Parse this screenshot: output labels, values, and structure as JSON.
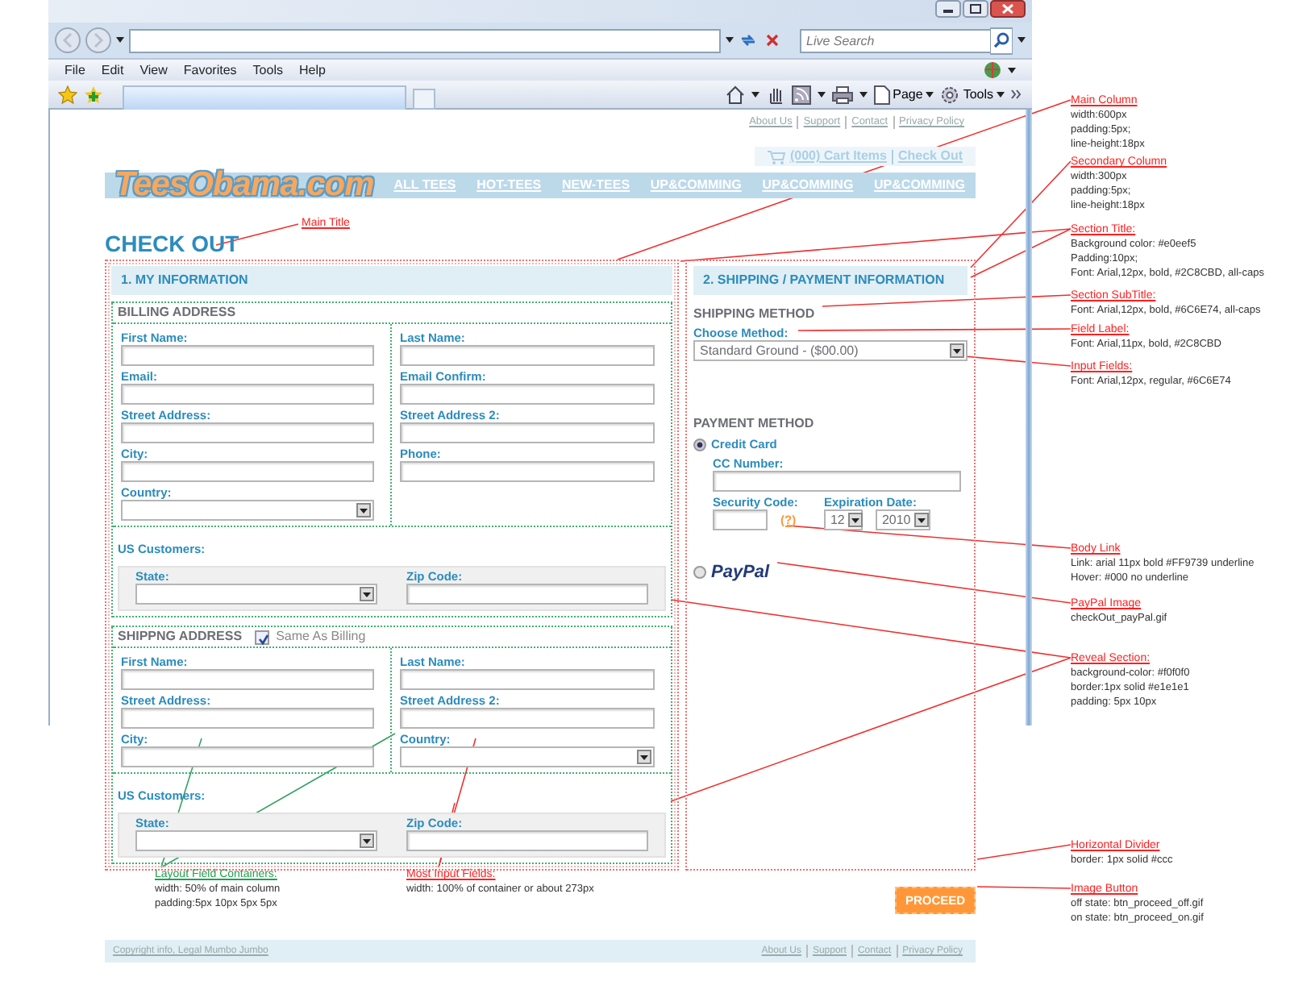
{
  "browser": {
    "search_placeholder": "Live Search",
    "menu": [
      "File",
      "Edit",
      "View",
      "Favorites",
      "Tools",
      "Help"
    ],
    "toolbar_buttons": [
      "Page",
      "Tools"
    ]
  },
  "site": {
    "top_links": [
      "About Us",
      "Support",
      "Contact",
      "Privacy Policy"
    ],
    "cart_link": "(000) Cart Items",
    "checkout_link": "Check Out",
    "logo": "TeesObama.com",
    "nav": [
      "ALL TEES",
      "HOT-TEES",
      "NEW-TEES",
      "UP&COMMING",
      "UP&COMMING",
      "UP&COMMING"
    ]
  },
  "page_title": "CHECK OUT",
  "main_column": {
    "section_title": "1. MY INFORMATION",
    "billing": {
      "title": "BILLING ADDRESS",
      "left_fields": [
        {
          "label": "First Name:",
          "kind": "text"
        },
        {
          "label": "Email:",
          "kind": "text"
        },
        {
          "label": "Street Address:",
          "kind": "text"
        },
        {
          "label": "City:",
          "kind": "text"
        },
        {
          "label": "Country:",
          "kind": "select"
        }
      ],
      "right_fields": [
        {
          "label": "Last Name:",
          "kind": "text"
        },
        {
          "label": "Email Confirm:",
          "kind": "text"
        },
        {
          "label": "Street Address 2:",
          "kind": "text"
        },
        {
          "label": "Phone:",
          "kind": "text"
        }
      ],
      "us_customers": {
        "label": "US Customers:",
        "fields": [
          {
            "label": "State:",
            "kind": "select"
          },
          {
            "label": "Zip Code:",
            "kind": "text"
          }
        ]
      }
    },
    "shipping": {
      "title": "SHIPPNG ADDRESS",
      "same_as_billing": {
        "label": "Same As Billing",
        "checked": true
      },
      "left_fields": [
        {
          "label": "First Name:",
          "kind": "text"
        },
        {
          "label": "Street Address:",
          "kind": "text"
        },
        {
          "label": "City:",
          "kind": "text"
        }
      ],
      "right_fields": [
        {
          "label": "Last Name:",
          "kind": "text"
        },
        {
          "label": "Street Address 2:",
          "kind": "text"
        },
        {
          "label": "Country:",
          "kind": "select"
        }
      ],
      "us_customers": {
        "label": "US Customers:",
        "fields": [
          {
            "label": "State:",
            "kind": "select"
          },
          {
            "label": "Zip Code:",
            "kind": "text"
          }
        ]
      }
    }
  },
  "secondary_column": {
    "section_title": "2. SHIPPING / PAYMENT INFORMATION",
    "shipping_method": {
      "title": "SHIPPING METHOD",
      "label": "Choose Method:",
      "value": "Standard Ground - ($00.00)"
    },
    "payment": {
      "title": "PAYMENT METHOD",
      "options": [
        {
          "kind": "card",
          "label": "Credit Card",
          "selected": true,
          "cc_number_label": "CC Number:",
          "security_code_label": "Security Code:",
          "help_link": "(?)",
          "expiration_label": "Expiration Date:",
          "month": "12",
          "year": "2010"
        },
        {
          "kind": "paypal",
          "label": "PayPal",
          "selected": false
        }
      ]
    }
  },
  "proceed_button": "PROCEED",
  "footer": {
    "copyright": "Copyright info, Legal Mumbo Jumbo",
    "links": [
      "About Us",
      "Support",
      "Contact",
      "Privacy Policy"
    ]
  },
  "annotations": [
    {
      "title": "Main Title",
      "color": "#ff2020"
    },
    {
      "title": "Main Column",
      "lines": [
        "width:600px",
        "padding:5px;",
        "line-height:18px"
      ],
      "color": "#ff2020"
    },
    {
      "title": "Secondary Column",
      "lines": [
        "width:300px",
        "padding:5px;",
        "line-height:18px"
      ],
      "color": "#ff2020"
    },
    {
      "title": "Section Title:",
      "lines": [
        "Background color: #e0eef5",
        "Padding:10px;",
        "Font: Arial,12px, bold, #2C8CBD, all-caps"
      ],
      "color": "#ff2020"
    },
    {
      "title": "Section SubTitle:",
      "lines": [
        "Font: Arial,12px, bold, #6C6E74, all-caps"
      ],
      "color": "#ff2020"
    },
    {
      "title": "Field Label:",
      "lines": [
        "Font: Arial,11px, bold, #2C8CBD"
      ],
      "color": "#ff2020"
    },
    {
      "title": "Input Fields:",
      "lines": [
        "Font: Arial,12px, regular, #6C6E74"
      ],
      "color": "#ff2020"
    },
    {
      "title": "Body Link",
      "lines": [
        "Link: arial 11px bold #FF9739 underline",
        "Hover:  #000 no underline"
      ],
      "color": "#ff2020"
    },
    {
      "title": "PayPal Image",
      "lines": [
        "checkOut_payPal.gif"
      ],
      "color": "#ff2020"
    },
    {
      "title": "Reveal Section:",
      "lines": [
        "background-color: #f0f0f0",
        "border:1px solid #e1e1e1",
        "padding: 5px 10px"
      ],
      "color": "#ff2020"
    },
    {
      "title": "Horizontal Divider",
      "lines": [
        "border: 1px solid #ccc"
      ],
      "color": "#ff2020"
    },
    {
      "title": "Image Button",
      "lines": [
        "off state: btn_proceed_off.gif",
        "on state: btn_proceed_on.gif"
      ],
      "color": "#ff2020"
    },
    {
      "title": "Layout Field Containers:",
      "lines": [
        "width: 50% of main column",
        "padding:5px 10px 5px 5px"
      ],
      "color": "#20a050"
    },
    {
      "title": "Most Input Fields:",
      "lines": [
        "width: 100% of container or about 273px"
      ],
      "color": "#ff2020"
    }
  ]
}
